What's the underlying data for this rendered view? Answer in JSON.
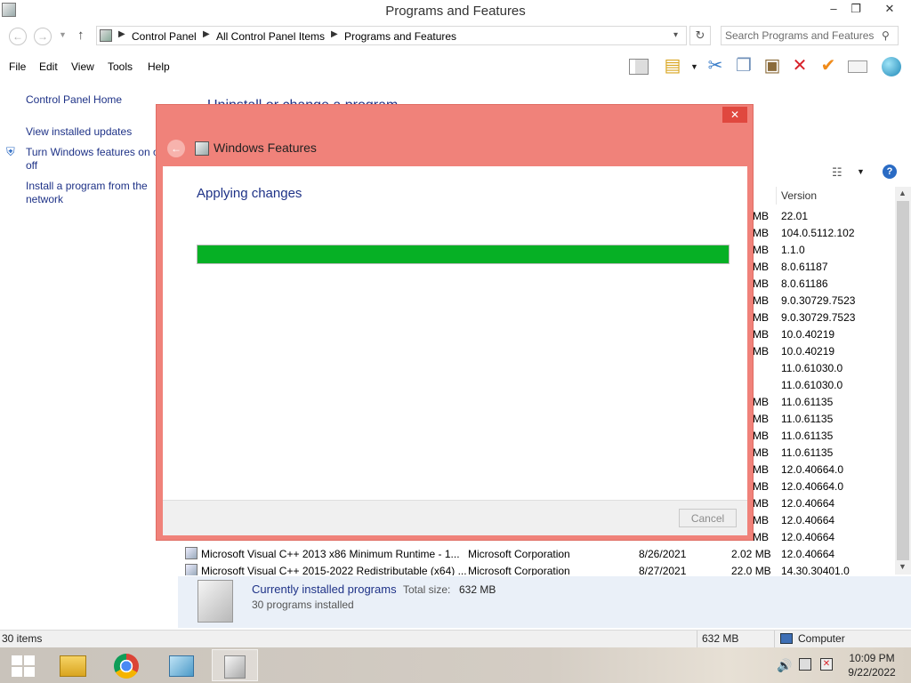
{
  "window": {
    "title": "Programs and Features",
    "minimize": "–",
    "restore": "❐",
    "close": "✕"
  },
  "address": {
    "crumbs": [
      "Control Panel",
      "All Control Panel Items",
      "Programs and Features"
    ],
    "search_placeholder": "Search Programs and Features"
  },
  "menu": [
    "File",
    "Edit",
    "View",
    "Tools",
    "Help"
  ],
  "left_pane": {
    "home": "Control Panel Home",
    "updates": "View installed updates",
    "features_line1": "Turn Windows features on o",
    "features_line2": "off",
    "install_line1": "Install a program from the",
    "install_line2": "network"
  },
  "main": {
    "heading": "Uninstall or change a program",
    "version_header": "Version"
  },
  "rows": [
    {
      "size": "MB",
      "version": "22.01"
    },
    {
      "size": "MB",
      "version": "104.0.5112.102"
    },
    {
      "size": "MB",
      "version": "1.1.0"
    },
    {
      "size": "MB",
      "version": "8.0.61187"
    },
    {
      "size": "MB",
      "version": "8.0.61186"
    },
    {
      "size": "MB",
      "version": "9.0.30729.7523"
    },
    {
      "size": "MB",
      "version": "9.0.30729.7523"
    },
    {
      "size": "MB",
      "version": "10.0.40219"
    },
    {
      "size": "MB",
      "version": "10.0.40219"
    },
    {
      "size": "",
      "version": "11.0.61030.0"
    },
    {
      "size": "",
      "version": "11.0.61030.0"
    },
    {
      "size": "MB",
      "version": "11.0.61135"
    },
    {
      "size": "MB",
      "version": "11.0.61135"
    },
    {
      "size": "MB",
      "version": "11.0.61135"
    },
    {
      "size": "MB",
      "version": "11.0.61135"
    },
    {
      "size": "MB",
      "version": "12.0.40664.0"
    },
    {
      "size": "MB",
      "version": "12.0.40664.0"
    },
    {
      "size": "MB",
      "version": "12.0.40664"
    },
    {
      "size": "MB",
      "version": "12.0.40664"
    },
    {
      "size": "MB",
      "version": "12.0.40664"
    }
  ],
  "full_rows": [
    {
      "name": "Microsoft Visual C++ 2013 x86 Minimum Runtime - 1...",
      "publisher": "Microsoft Corporation",
      "installed": "8/26/2021",
      "size": "2.02 MB",
      "version": "12.0.40664"
    },
    {
      "name": "Microsoft Visual C++ 2015-2022 Redistributable (x64) ...",
      "publisher": "Microsoft Corporation",
      "installed": "8/27/2021",
      "size": "22.0 MB",
      "version": "14.30.30401.0"
    }
  ],
  "details": {
    "title": "Currently installed programs",
    "total_label": "Total size:",
    "total_value": "632 MB",
    "count": "30 programs installed"
  },
  "status": {
    "items": "30 items",
    "size": "632 MB",
    "location": "Computer"
  },
  "taskbar": {
    "time": "10:09 PM",
    "date": "9/22/2022"
  },
  "dialog": {
    "title": "Windows Features",
    "status": "Applying changes",
    "progress": 1.0,
    "cancel_label": "Cancel",
    "close": "✕",
    "back": "←"
  },
  "colors": {
    "progress_fill": "#06b025",
    "dialog_frame": "#f0827a",
    "link": "#1e3287"
  }
}
